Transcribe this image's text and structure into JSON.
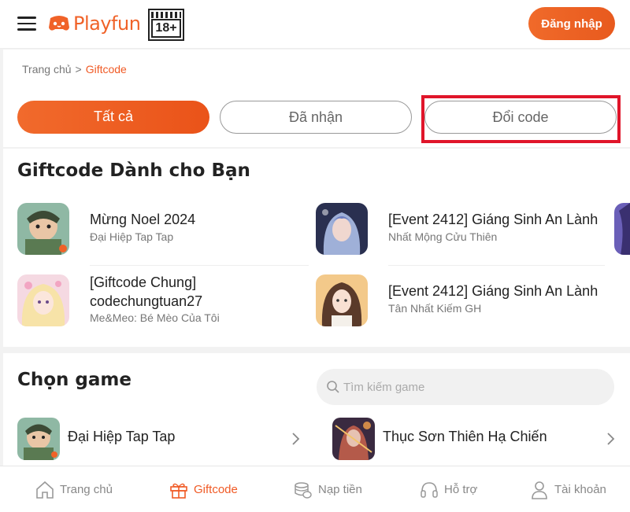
{
  "header": {
    "logo_text": "Playfun",
    "age_rating": "18+",
    "login_label": "Đăng nhập"
  },
  "breadcrumb": {
    "home": "Trang chủ",
    "separator": ">",
    "current": "Giftcode"
  },
  "tabs": [
    {
      "label": "Tất cả",
      "active": true
    },
    {
      "label": "Đã nhận",
      "active": false
    },
    {
      "label": "Đổi code",
      "active": false,
      "highlighted": true
    }
  ],
  "giftcodes": {
    "title": "Giftcode Dành cho Bạn",
    "items": [
      {
        "title": "Mừng Noel 2024",
        "game": "Đại Hiệp Tap Tap"
      },
      {
        "title": "[Event 2412] Giáng Sinh An Lành",
        "game": "Nhất Mộng Cửu Thiên"
      },
      {
        "title_line1": "[Giftcode Chung]",
        "title_line2": "codechungtuan27",
        "game": "Me&Meo: Bé Mèo Của Tôi"
      },
      {
        "title": "[Event 2412] Giáng Sinh An Lành",
        "game": "Tân Nhất Kiếm GH"
      }
    ]
  },
  "choose_game": {
    "title": "Chọn game",
    "search_placeholder": "Tìm kiếm game",
    "games": [
      {
        "name": "Đại Hiệp Tap Tap"
      },
      {
        "name": "Thục Sơn Thiên Hạ Chiến"
      }
    ]
  },
  "bottom_nav": [
    {
      "label": "Trang chủ",
      "icon": "home-icon",
      "active": false
    },
    {
      "label": "Giftcode",
      "icon": "gift-icon",
      "active": true
    },
    {
      "label": "Nạp tiền",
      "icon": "coins-icon",
      "active": false
    },
    {
      "label": "Hỗ trợ",
      "icon": "headset-icon",
      "active": false
    },
    {
      "label": "Tài khoản",
      "icon": "user-icon",
      "active": false
    }
  ],
  "colors": {
    "accent": "#f05a25",
    "highlight_box": "#e0152a"
  }
}
